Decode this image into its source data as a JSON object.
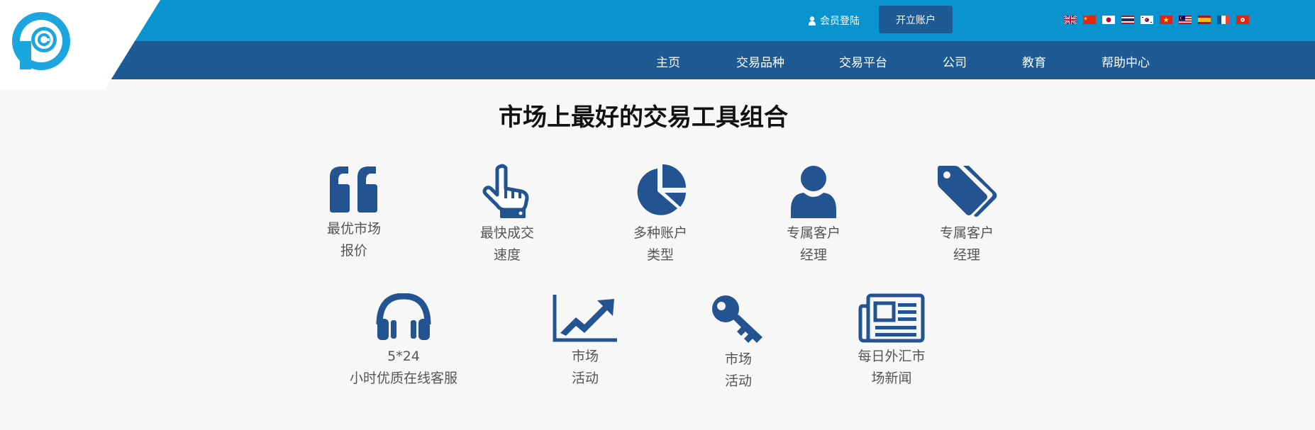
{
  "header": {
    "login_label": "会员登陆",
    "open_account_label": "开立账户",
    "flags": [
      "uk-flag",
      "china-flag",
      "japan-flag",
      "thailand-flag",
      "korea-flag",
      "vietnam-flag",
      "malaysia-flag",
      "spain-flag",
      "france-flag",
      "hongkong-flag"
    ]
  },
  "nav": {
    "items": [
      {
        "label": "主页"
      },
      {
        "label": "交易品种"
      },
      {
        "label": "交易平台"
      },
      {
        "label": "公司"
      },
      {
        "label": "教育"
      },
      {
        "label": "帮助中心"
      }
    ]
  },
  "main": {
    "title": "市场上最好的交易工具组合",
    "features": [
      {
        "icon": "quote-icon",
        "line1": "最优市场",
        "line2": "报价"
      },
      {
        "icon": "hand-pointer-icon",
        "line1": "最快成交",
        "line2": "速度"
      },
      {
        "icon": "pie-chart-icon",
        "line1": "多种账户",
        "line2": "类型"
      },
      {
        "icon": "user-icon",
        "line1": "专属客户",
        "line2": "经理"
      },
      {
        "icon": "tags-icon",
        "line1": "专属客户",
        "line2": "经理"
      },
      {
        "icon": "headphones-icon",
        "line1": "5*24",
        "line2": "小时优质在线客服"
      },
      {
        "icon": "line-chart-icon",
        "line1": "市场",
        "line2": "活动"
      },
      {
        "icon": "key-icon",
        "line1": "市场",
        "line2": "活动"
      },
      {
        "icon": "newspaper-icon",
        "line1": "每日外汇市",
        "line2": "场新闻"
      }
    ]
  },
  "colors": {
    "topbar": "#0a94cf",
    "navbar": "#1e5a94",
    "icon": "#235390",
    "logo": "#1ba6e0"
  }
}
